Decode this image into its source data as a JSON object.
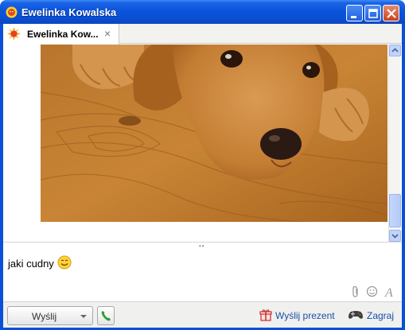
{
  "window": {
    "title": "Ewelinka Kowalska",
    "controls": [
      "minimize-icon",
      "maximize-icon",
      "close-icon"
    ]
  },
  "tabs": [
    {
      "label": "Ewelinka Kow...",
      "icon": "sun-status-icon",
      "close": "×"
    }
  ],
  "chat": {
    "image": "dog-photo"
  },
  "input": {
    "text": "jaki cudny",
    "emoticon": "smiley-icon",
    "format_icons": [
      "attachment-icon",
      "emoticon-icon",
      "font-icon"
    ]
  },
  "bottom": {
    "send_label": "Wyślij",
    "call_icon": "phone-icon",
    "gift_label": "Wyślij prezent",
    "game_label": "Zagraj"
  },
  "colors": {
    "titlebar": "#0a4fd4",
    "link": "#1a4fa8",
    "call_green": "#2e9e2e"
  }
}
